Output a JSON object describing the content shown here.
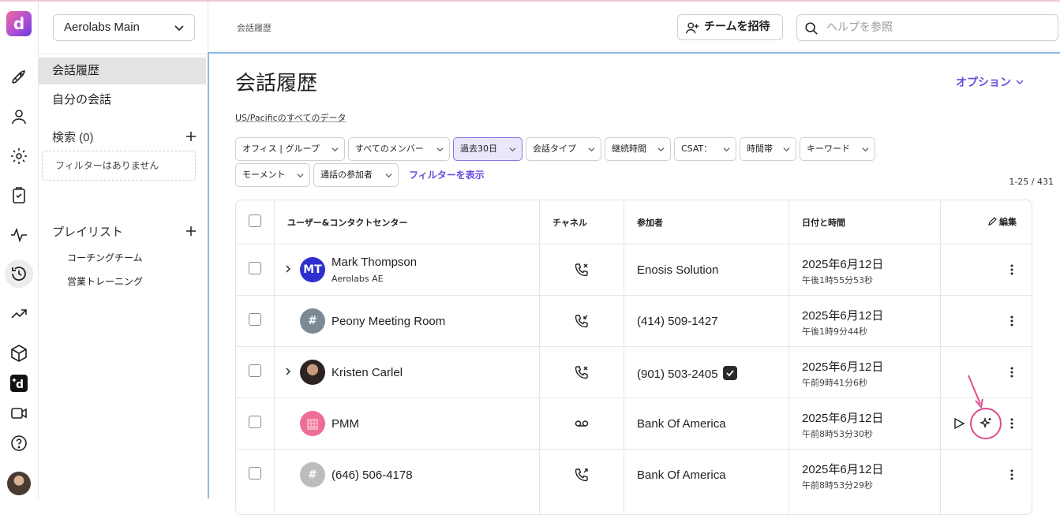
{
  "app": {
    "logo_letter": "d",
    "workspace": "Aerolabs Main"
  },
  "sidebar": {
    "items": [
      {
        "label": "会話履歴",
        "active": true
      },
      {
        "label": "自分の会話",
        "active": false
      }
    ],
    "search_label": "検索 (0)",
    "no_filter": "フィルターはありません",
    "playlist_label": "プレイリスト",
    "playlists": [
      "コーチングチーム",
      "営業トレーニング"
    ]
  },
  "header": {
    "breadcrumb": "会話履歴",
    "invite_label": "チームを招待",
    "help_placeholder": "ヘルプを参照"
  },
  "page": {
    "title": "会話履歴",
    "options_label": "オプション",
    "timezone_link": "US/Pacificのすべてのデータ",
    "show_filters": "フィルターを表示",
    "count": "1-25 / 431"
  },
  "filters": [
    {
      "label": "オフィス | グループ",
      "selected": false
    },
    {
      "label": "すべてのメンバー",
      "selected": false
    },
    {
      "label": "過去30日",
      "selected": true
    },
    {
      "label": "会話タイプ",
      "selected": false
    },
    {
      "label": "継続時間",
      "selected": false
    },
    {
      "label": "CSAT：",
      "selected": false
    },
    {
      "label": "時間帯",
      "selected": false
    },
    {
      "label": "キーワード",
      "selected": false
    },
    {
      "label": "モーメント",
      "selected": false
    },
    {
      "label": "通話の参加者",
      "selected": false
    }
  ],
  "table": {
    "headers": {
      "user": "ユーザー&コンタクトセンター",
      "channel": "チャネル",
      "participant": "参加者",
      "datetime": "日付と時間",
      "edit": "編集"
    },
    "rows": [
      {
        "name": "Mark Thompson",
        "sub": "Aerolabs AE",
        "avatar_text": "MT",
        "avatar_color": "#2f2fd0",
        "channel_icon": "phone-missed-icon",
        "participant": "Enosis Solution",
        "verified": false,
        "date": "2025年6月12日",
        "time": "午後1時55分53秒",
        "expandable": true
      },
      {
        "name": "Peony Meeting Room",
        "sub": "",
        "avatar_text": "#",
        "avatar_color": "#7c8a96",
        "channel_icon": "phone-incoming-icon",
        "participant": "(414) 509-1427",
        "verified": false,
        "date": "2025年6月12日",
        "time": "午後1時9分44秒",
        "expandable": false
      },
      {
        "name": "Kristen Carlel",
        "sub": "",
        "avatar_text": "",
        "avatar_color": "#3a3a3a",
        "channel_icon": "phone-missed-icon",
        "participant": "(901) 503-2405",
        "verified": true,
        "date": "2025年6月12日",
        "time": "午前9時41分6秒",
        "expandable": true
      },
      {
        "name": "PMM",
        "sub": "",
        "avatar_text": "",
        "avatar_color": "#ee6d94",
        "channel_icon": "voicemail-icon",
        "participant": "Bank Of America",
        "verified": false,
        "date": "2025年6月12日",
        "time": "午前8時53分30秒",
        "expandable": false
      },
      {
        "name": "(646) 506-4178",
        "sub": "",
        "avatar_text": "#",
        "avatar_color": "#bdbdbd",
        "channel_icon": "phone-outgoing-icon",
        "participant": "Bank Of America",
        "verified": false,
        "date": "2025年6月12日",
        "time": "午前8時53分29秒",
        "expandable": false
      }
    ]
  },
  "colors": {
    "accent": "#6a4be0",
    "highlight": "#e04a8a"
  }
}
